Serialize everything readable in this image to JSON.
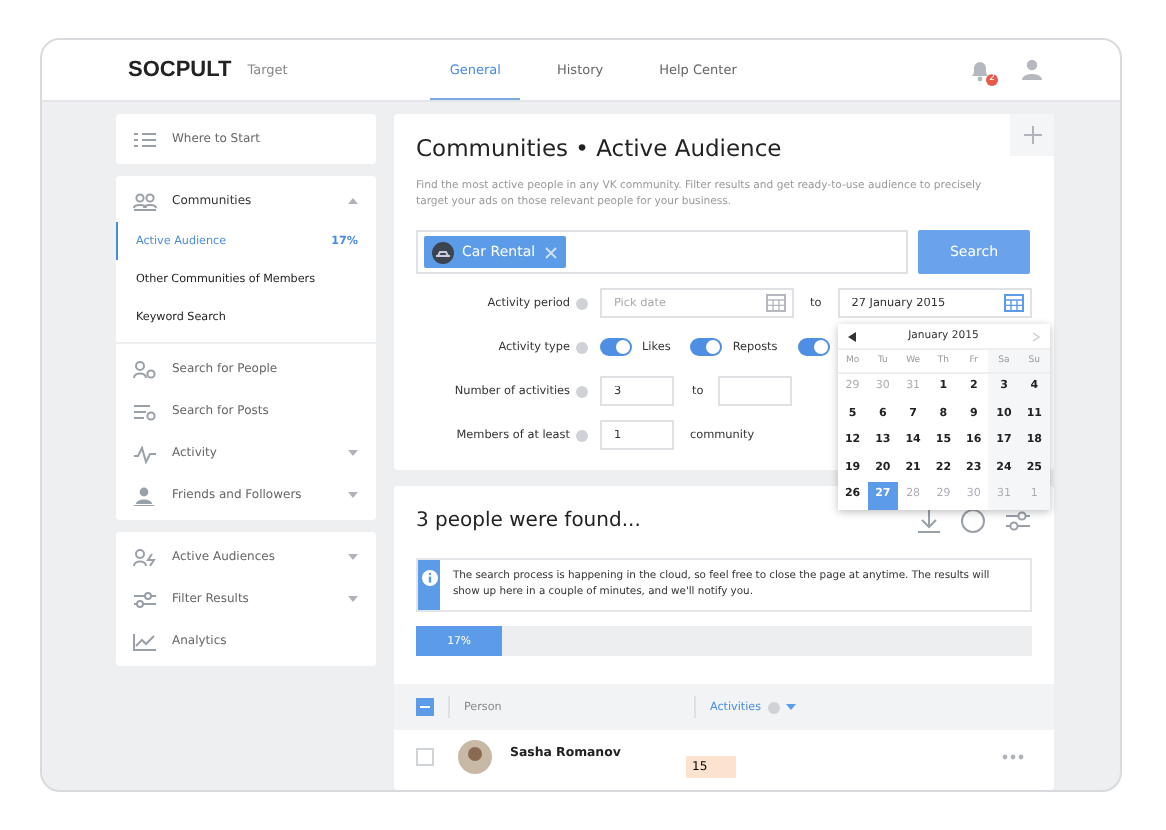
{
  "header": {
    "logo": "SOCPULT",
    "product": "Target",
    "tabs": [
      {
        "label": "General",
        "selected": true
      },
      {
        "label": "History",
        "selected": false
      },
      {
        "label": "Help Center",
        "selected": false
      }
    ],
    "notifications": "2"
  },
  "sidebar": {
    "groups": [
      {
        "items": [
          {
            "label": "Where to Start"
          }
        ]
      },
      {
        "items": [
          {
            "label": "Communities",
            "expanded": true,
            "children": [
              {
                "label": "Active Audience",
                "badge": "17%",
                "selected": true
              },
              {
                "label": "Other Communities of Members",
                "selected": false
              },
              {
                "label": "Keyword Search",
                "selected": false
              }
            ]
          },
          {
            "label": "Search for People"
          },
          {
            "label": "Search for Posts"
          },
          {
            "label": "Activity",
            "expanded": false
          },
          {
            "label": "Friends and Followers",
            "expanded": false
          }
        ]
      },
      {
        "items": [
          {
            "label": "Active Audiences",
            "expanded": false
          },
          {
            "label": "Filter Results",
            "expanded": false
          },
          {
            "label": "Analytics"
          }
        ]
      }
    ]
  },
  "search_panel": {
    "title": "Communities • Active Audience",
    "description": "Find the most active people in any VK community. Filter results and get ready-to-use audience to precisely target your ads on those relevant people for your business.",
    "tags": [
      {
        "label": "Car Rental"
      }
    ],
    "search_button": "Search",
    "activity_period": {
      "label": "Activity period",
      "from": {
        "placeholder": "Pick date"
      },
      "separator": "to",
      "to": {
        "value": "27 January 2015"
      }
    },
    "activity_type": {
      "label": "Activity type",
      "toggles": [
        {
          "label": "Likes",
          "on": true
        },
        {
          "label": "Reposts",
          "on": true
        },
        {
          "on": true
        }
      ]
    },
    "number_of_activities": {
      "label": "Number of activities",
      "from": "3",
      "separator": "to"
    },
    "members": {
      "label": "Members of at least",
      "value": "1",
      "suffix": "community"
    },
    "calendar": {
      "month": "January 2015",
      "weekdays": [
        "Mo",
        "Tu",
        "We",
        "Th",
        "Fr",
        "Sa",
        "Su"
      ],
      "days": [
        {
          "label": "29",
          "muted": true,
          "selected": false
        },
        {
          "label": "30",
          "muted": true,
          "selected": false
        },
        {
          "label": "31",
          "muted": true,
          "selected": false
        },
        {
          "label": "1",
          "muted": false,
          "selected": false
        },
        {
          "label": "2",
          "muted": false,
          "selected": false
        },
        {
          "label": "3",
          "muted": false,
          "selected": false
        },
        {
          "label": "4",
          "muted": false,
          "selected": false
        },
        {
          "label": "5",
          "muted": false,
          "selected": false
        },
        {
          "label": "6",
          "muted": false,
          "selected": false
        },
        {
          "label": "7",
          "muted": false,
          "selected": false
        },
        {
          "label": "8",
          "muted": false,
          "selected": false
        },
        {
          "label": "9",
          "muted": false,
          "selected": false
        },
        {
          "label": "10",
          "muted": false,
          "selected": false
        },
        {
          "label": "11",
          "muted": false,
          "selected": false
        },
        {
          "label": "12",
          "muted": false,
          "selected": false
        },
        {
          "label": "13",
          "muted": false,
          "selected": false
        },
        {
          "label": "14",
          "muted": false,
          "selected": false
        },
        {
          "label": "15",
          "muted": false,
          "selected": false
        },
        {
          "label": "16",
          "muted": false,
          "selected": false
        },
        {
          "label": "17",
          "muted": false,
          "selected": false
        },
        {
          "label": "18",
          "muted": false,
          "selected": false
        },
        {
          "label": "19",
          "muted": false,
          "selected": false
        },
        {
          "label": "20",
          "muted": false,
          "selected": false
        },
        {
          "label": "21",
          "muted": false,
          "selected": false
        },
        {
          "label": "22",
          "muted": false,
          "selected": false
        },
        {
          "label": "23",
          "muted": false,
          "selected": false
        },
        {
          "label": "24",
          "muted": false,
          "selected": false
        },
        {
          "label": "25",
          "muted": false,
          "selected": false
        },
        {
          "label": "26",
          "muted": false,
          "selected": false
        },
        {
          "label": "27",
          "muted": false,
          "selected": true
        },
        {
          "label": "28",
          "muted": true,
          "selected": false
        },
        {
          "label": "29",
          "muted": true,
          "selected": false
        },
        {
          "label": "30",
          "muted": true,
          "selected": false
        },
        {
          "label": "31",
          "muted": true,
          "selected": false
        },
        {
          "label": "1",
          "muted": true,
          "selected": false
        }
      ]
    }
  },
  "results": {
    "title": "3 people were found...",
    "notice": "The search process is happening in the cloud, so feel free to close the page at anytime. The results will show up here in a couple of minutes, and we'll notify you.",
    "progress": {
      "level": 0.14,
      "label": "17%"
    },
    "table": {
      "columns": [
        {
          "label": "Person",
          "sorted": false
        },
        {
          "label": "Activities",
          "sorted": true
        }
      ],
      "select_all": true,
      "rows": [
        {
          "name": "Sasha Romanov",
          "activities": "15",
          "checked": false
        }
      ]
    }
  }
}
